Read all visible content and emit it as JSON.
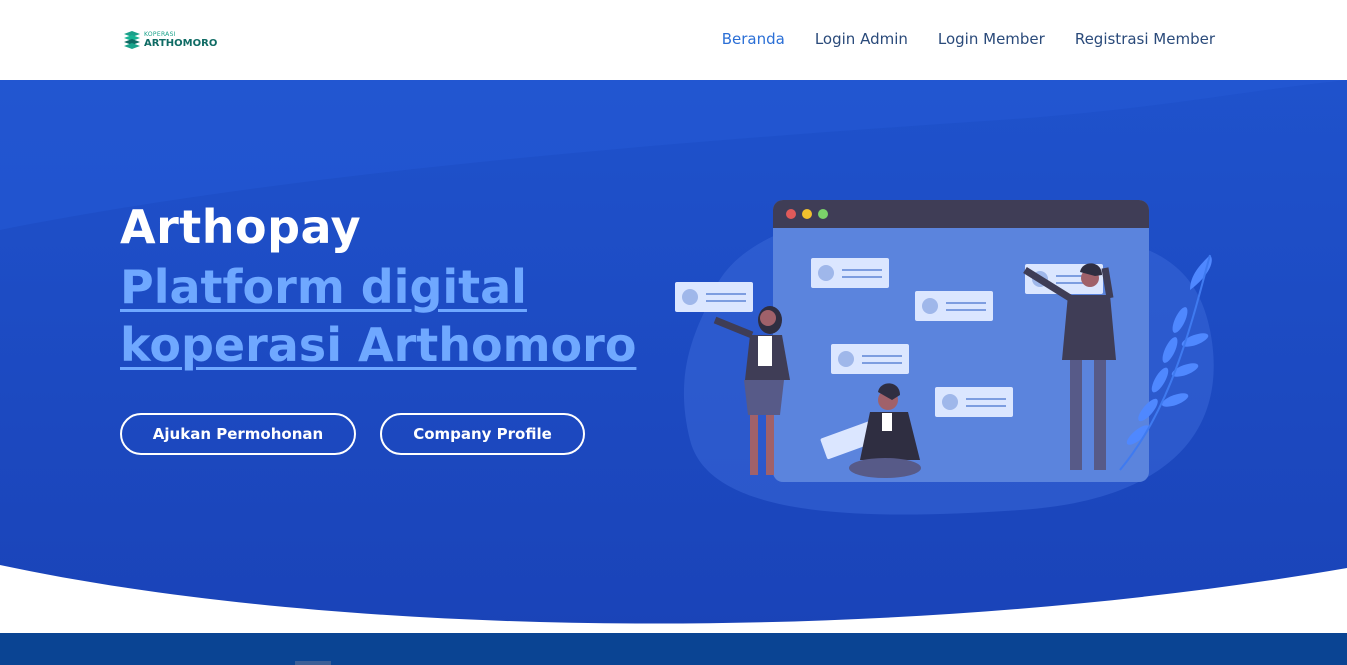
{
  "header": {
    "logo_small": "KOPERASI",
    "logo_big": "ARTHOMORO",
    "nav": [
      {
        "label": "Beranda",
        "active": true
      },
      {
        "label": "Login Admin"
      },
      {
        "label": "Login Member"
      },
      {
        "label": "Registrasi Member"
      }
    ]
  },
  "hero": {
    "title": "Arthopay",
    "subtitle": "Platform digital koperasi Arthomoro",
    "buttons": {
      "apply": "Ajukan Permohonan",
      "profile": "Company Profile"
    }
  },
  "colors": {
    "hero_blue": "#1f4fcc",
    "accent_link": "#6fa8ff",
    "footer": "#0a4493",
    "nav_active": "#2b6fd6"
  },
  "icons": [
    "logo-mark",
    "browser-window-illustration",
    "leaf-decoration"
  ]
}
